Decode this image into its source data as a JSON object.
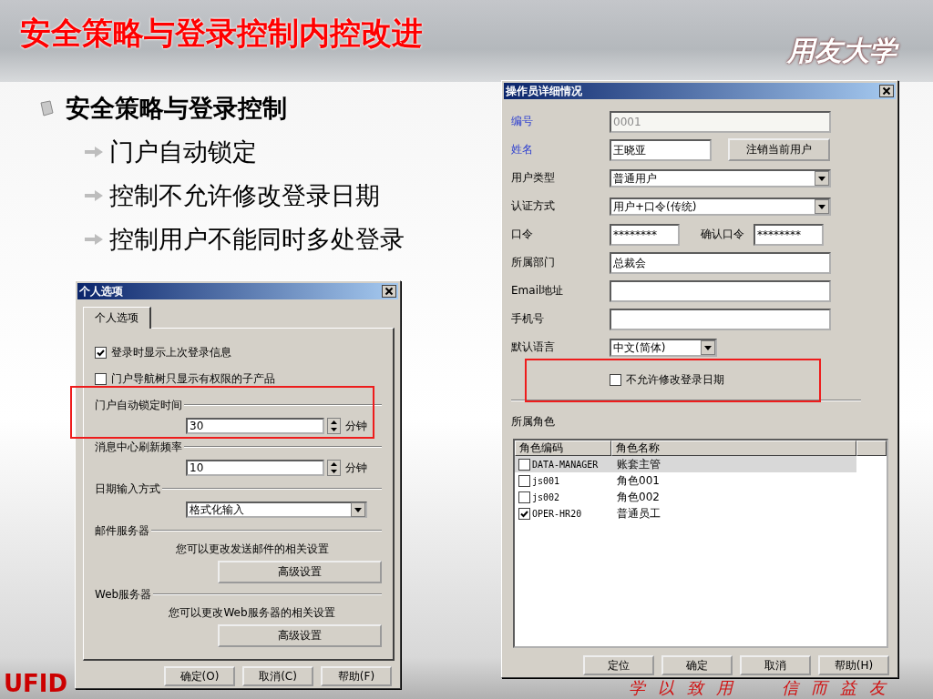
{
  "slide": {
    "title": "安全策略与登录控制内控改进",
    "logo_text": "用友大学",
    "bullets": [
      {
        "text": "安全策略与登录控制",
        "children": [
          {
            "text": "门户自动锁定"
          },
          {
            "text": "控制不允许修改登录日期"
          },
          {
            "text": "控制用户不能同时多处登录"
          }
        ]
      }
    ],
    "footer_logo": "UFID",
    "footer_motto": [
      "学以致用",
      "信而益友"
    ]
  },
  "personal_dialog": {
    "title": "个人选项",
    "tabs": [
      {
        "label": "个人选项",
        "selected": true
      }
    ],
    "checkboxes": [
      {
        "label": "登录时显示上次登录信息",
        "checked": true
      },
      {
        "label": "门户导航树只显示有权限的子产品",
        "checked": false
      }
    ],
    "groups": [
      {
        "kind": "spin",
        "label": "门户自动锁定时间",
        "value": "30",
        "unit": "分钟"
      },
      {
        "kind": "spin",
        "label": "消息中心刷新频率",
        "value": "10",
        "unit": "分钟"
      },
      {
        "kind": "select",
        "label": "日期输入方式",
        "value": "格式化输入"
      },
      {
        "kind": "action",
        "label": "邮件服务器",
        "description": "您可以更改发送邮件的相关设置",
        "button": "高级设置"
      },
      {
        "kind": "action",
        "label": "Web服务器",
        "description": "您可以更改Web服务器的相关设置",
        "button": "高级设置"
      }
    ],
    "buttons": [
      "确定(O)",
      "取消(C)",
      "帮助(F)"
    ]
  },
  "operator_dialog": {
    "title": "操作员详细情况",
    "fields": [
      {
        "kind": "text",
        "label": "编号",
        "value": "0001",
        "required": true,
        "disabled": true
      },
      {
        "kind": "text",
        "label": "姓名",
        "value": "王晓亚",
        "required": true,
        "disabled": false,
        "button": "注销当前用户"
      },
      {
        "kind": "select",
        "label": "用户类型",
        "value": "普通用户",
        "required": false
      },
      {
        "kind": "select",
        "label": "认证方式",
        "value": "用户+口令(传统)",
        "required": false
      },
      {
        "kind": "password",
        "label": "口令",
        "value": "********",
        "required": false,
        "confirm_label": "确认口令",
        "confirm_value": "********"
      },
      {
        "kind": "text",
        "label": "所属部门",
        "value": "总裁会",
        "required": false,
        "disabled": false
      },
      {
        "kind": "text",
        "label": "Email地址",
        "required": false,
        "disabled": false
      },
      {
        "kind": "text",
        "label": "手机号",
        "required": false,
        "disabled": false
      },
      {
        "kind": "small_select",
        "label": "默认语言",
        "value": "中文(简体)",
        "required": false
      }
    ],
    "checkbox": {
      "label": "不允许修改登录日期",
      "checked": false
    },
    "roles_label": "所属角色",
    "roles_table": {
      "columns": [
        "角色编码",
        "角色名称"
      ],
      "rows": [
        {
          "code": "DATA-MANAGER",
          "name": "账套主管",
          "checked": false,
          "selected": true
        },
        {
          "code": "js001",
          "name": "角色001",
          "checked": false,
          "selected": false
        },
        {
          "code": "js002",
          "name": "角色002",
          "checked": false,
          "selected": false
        },
        {
          "code": "OPER-HR20",
          "name": "普通员工",
          "checked": true,
          "selected": false
        }
      ]
    },
    "buttons": [
      "定位",
      "确定",
      "取消",
      "帮助(H)"
    ]
  }
}
